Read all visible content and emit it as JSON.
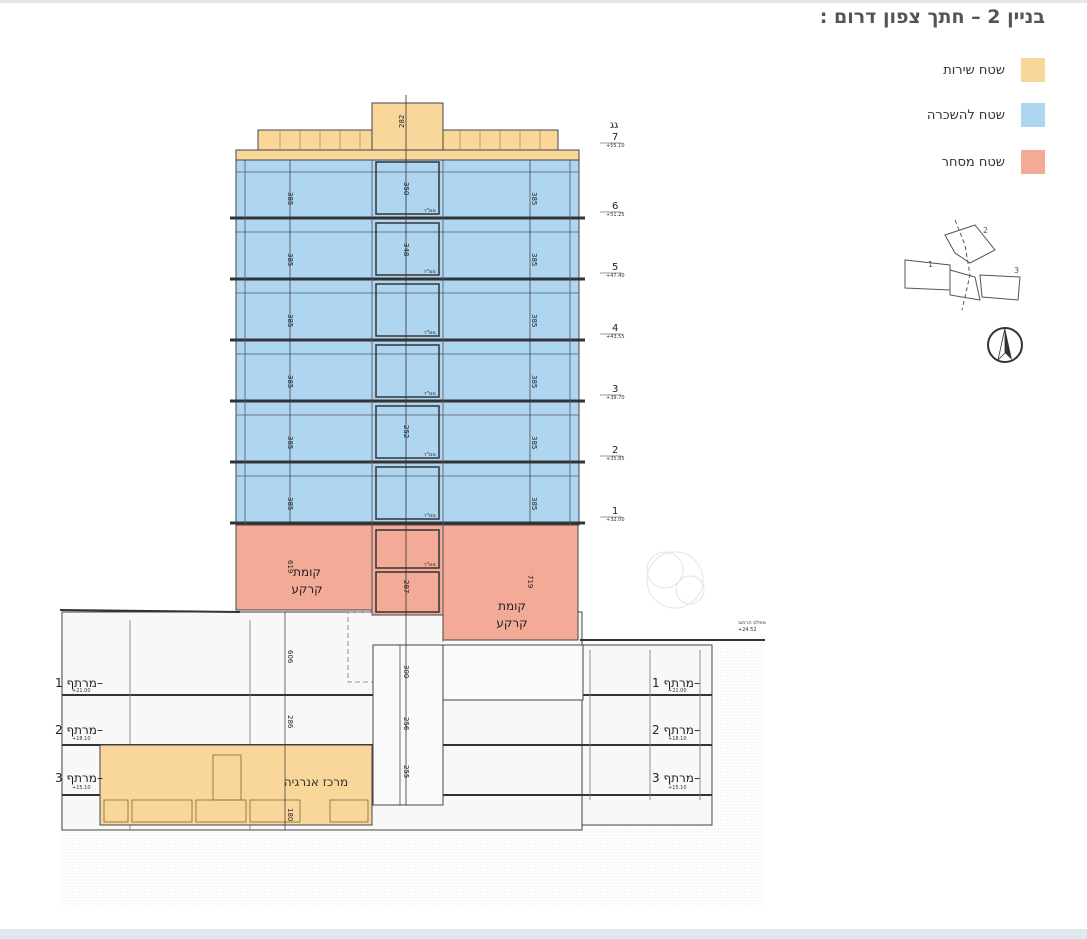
{
  "title": "בניין 2 – חתך צפון דרום :",
  "legend": [
    {
      "label": "שטח שירות",
      "color": "#f9d79a"
    },
    {
      "label": "שטח להשכרה",
      "color": "#aed6f0"
    },
    {
      "label": "שטח מסחר",
      "color": "#f3ab98"
    }
  ],
  "floor_labels": {
    "roof": "גג",
    "f7": "7",
    "f6": "6",
    "f5": "5",
    "f4": "4",
    "f3": "3",
    "f2": "2",
    "f1": "1",
    "e7": "+55.10",
    "e6": "+51.25",
    "e5": "+47.40",
    "e4": "+43.55",
    "e3": "+39.70",
    "e2": "+35.85",
    "e1": "+32.00"
  },
  "zone_labels": {
    "ground_left": "קומת\nקרקע",
    "ground_right": "קומת\nקרקע",
    "energy": "מרכז אנרגיה",
    "street": "מפלס הרחוב",
    "street_elev": "+24.52"
  },
  "basement_labels": {
    "b1": "מרתף 1–",
    "b2": "מרתף 2–",
    "b3": "מרתף 3–",
    "b1_elev": "+21.00",
    "b2_elev": "+18.10",
    "b3_elev": "+15.10"
  },
  "dimensions": {
    "d282": "282",
    "d385": "385",
    "d619": "619",
    "d719": "719",
    "d606": "606",
    "d300": "300",
    "d286": "286",
    "d256": "256",
    "d255": "255",
    "d350": "350",
    "d348": "348",
    "d252": "252",
    "d287": "287",
    "d180": "180",
    "mmd": "ממ\"ד"
  },
  "keymap": {
    "b1": "1",
    "b2": "2",
    "b3": "3"
  }
}
